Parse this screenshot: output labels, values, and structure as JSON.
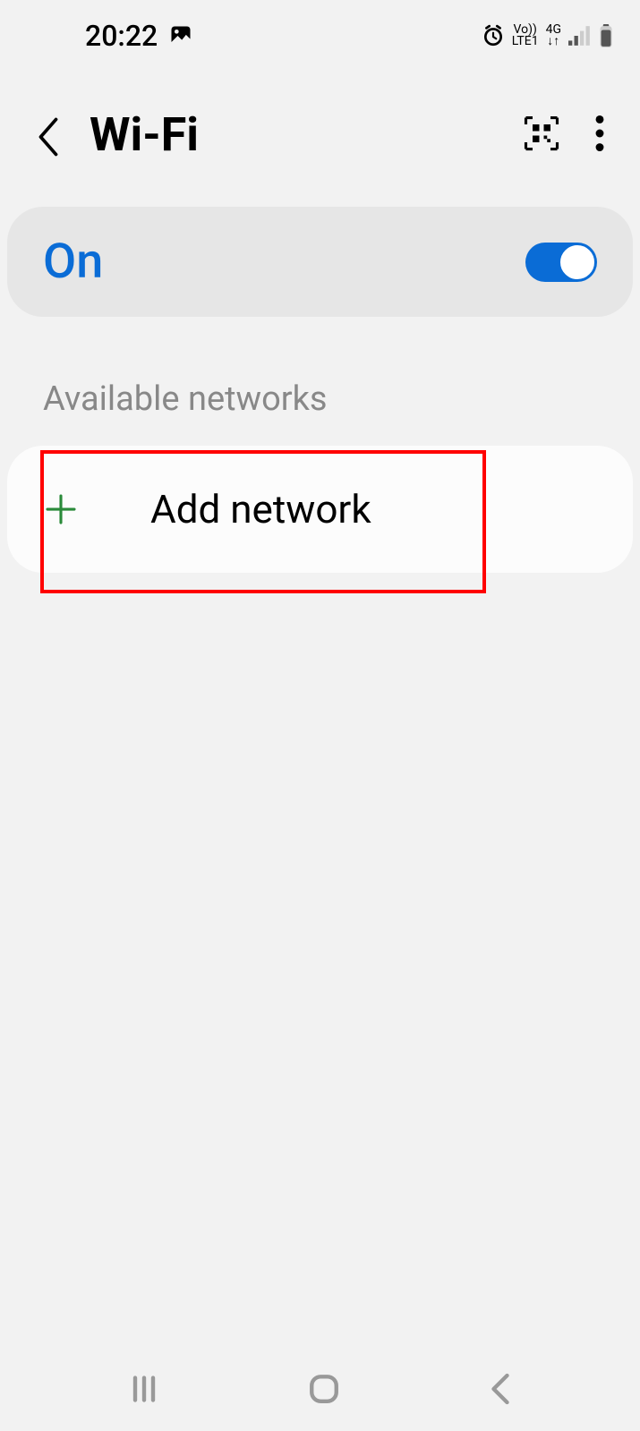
{
  "status_bar": {
    "time": "20:22",
    "volte": "Vo))",
    "lte": "LTE1",
    "network_type": "4G"
  },
  "header": {
    "title": "Wi-Fi"
  },
  "wifi_toggle": {
    "status_label": "On",
    "enabled": true
  },
  "section": {
    "available_networks_label": "Available networks"
  },
  "networks": {
    "add_network_label": "Add network"
  }
}
